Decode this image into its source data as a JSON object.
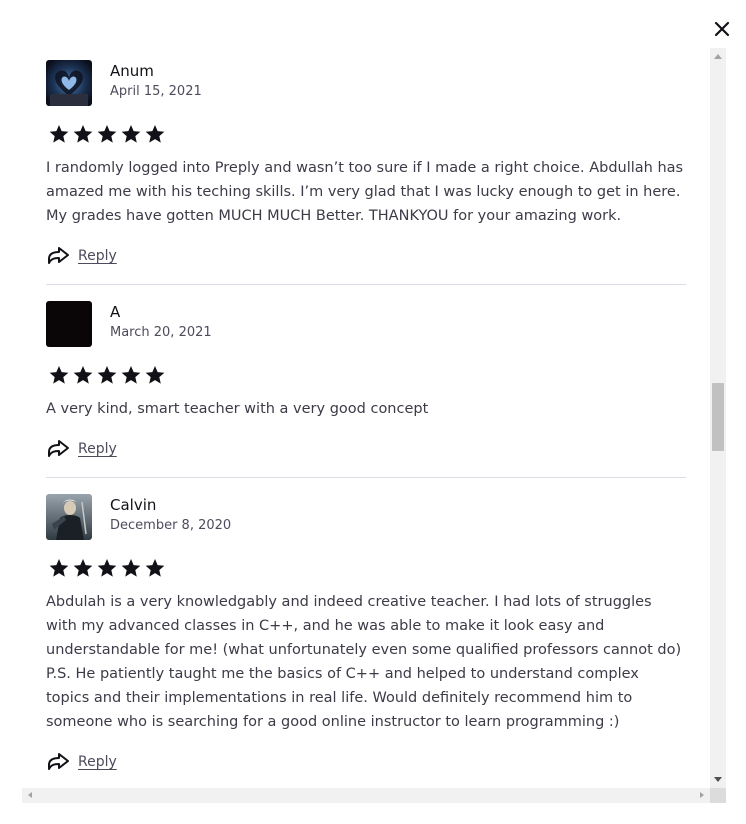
{
  "dialog": {
    "close_icon": "close-icon"
  },
  "reviews": [
    {
      "name": "Anum",
      "date": "April 15, 2021",
      "rating": 5,
      "text": "I randomly logged into Preply and wasn’t too sure if I made a right choice. Abdullah has amazed me with his teching skills. I’m very glad that I was lucky enough to get in here. My grades have gotten MUCH MUCH Better. THANKYOU for your amazing work.",
      "reply_label": "Reply",
      "avatar_icon": "avatar-photo-heart-hands"
    },
    {
      "name": "A",
      "date": "March 20, 2021",
      "rating": 5,
      "text": "A very kind, smart teacher with a very good concept",
      "reply_label": "Reply",
      "avatar_icon": "avatar-dark-square"
    },
    {
      "name": "Calvin",
      "date": "December 8, 2020",
      "rating": 5,
      "text": "Abdulah is a very knowledgably and indeed creative teacher. I had lots of struggles with my advanced classes in C++, and he was able to make it look easy and understandable for me! (what unfortunately even some qualified professors cannot do) P.S. He patiently taught me the basics of C++ and helped to understand complex topics and their implementations in real life. Would definitely recommend him to someone who is searching for a good online instructor to learn programming :)",
      "reply_label": "Reply",
      "avatar_icon": "avatar-photo-warrior"
    }
  ],
  "colors": {
    "text": "#121117",
    "muted": "#4d4c5c",
    "divider": "#dcdce5",
    "star": "#121117"
  }
}
